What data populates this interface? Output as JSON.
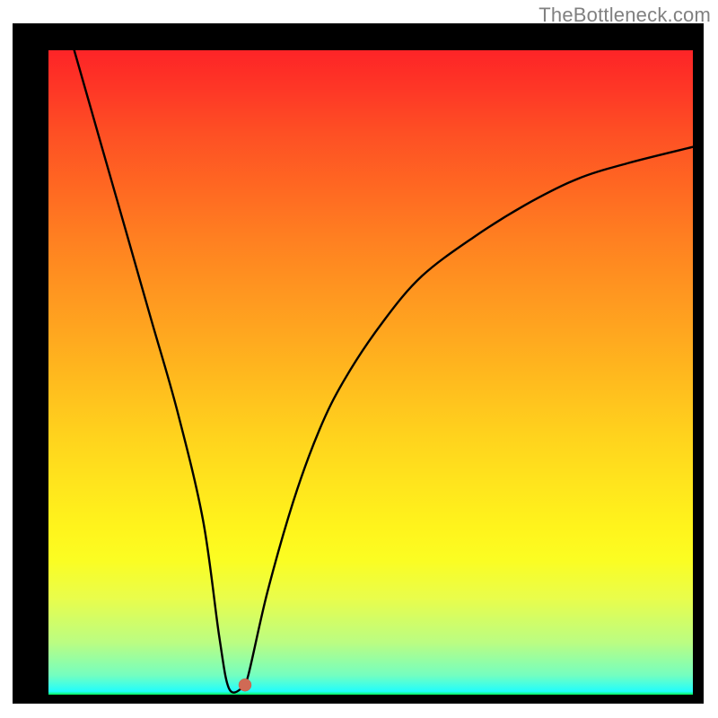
{
  "watermark": "TheBottleneck.com",
  "chart_data": {
    "type": "line",
    "title": "",
    "xlabel": "",
    "ylabel": "",
    "xlim": [
      0,
      100
    ],
    "ylim": [
      0,
      100
    ],
    "axes_visible": false,
    "background_gradient": [
      "#fd2427",
      "#ffe41d",
      "#06fd55"
    ],
    "background_meaning": "red = high bottleneck, green = no bottleneck",
    "series": [
      {
        "name": "bottleneck-curve",
        "x": [
          4,
          8,
          12,
          16,
          20,
          24,
          26.5,
          28,
          30,
          31,
          34,
          38,
          42,
          46,
          52,
          58,
          66,
          74,
          82,
          90,
          100
        ],
        "values": [
          100,
          86,
          72,
          58,
          44,
          27,
          9,
          1,
          1,
          3,
          16,
          30,
          41,
          49,
          58,
          65,
          71,
          76,
          80,
          82.5,
          85
        ]
      }
    ],
    "marker": {
      "x": 30.5,
      "y": 1.5,
      "meaning": "optimal point / minimum bottleneck"
    },
    "grid": false,
    "legend": false
  }
}
